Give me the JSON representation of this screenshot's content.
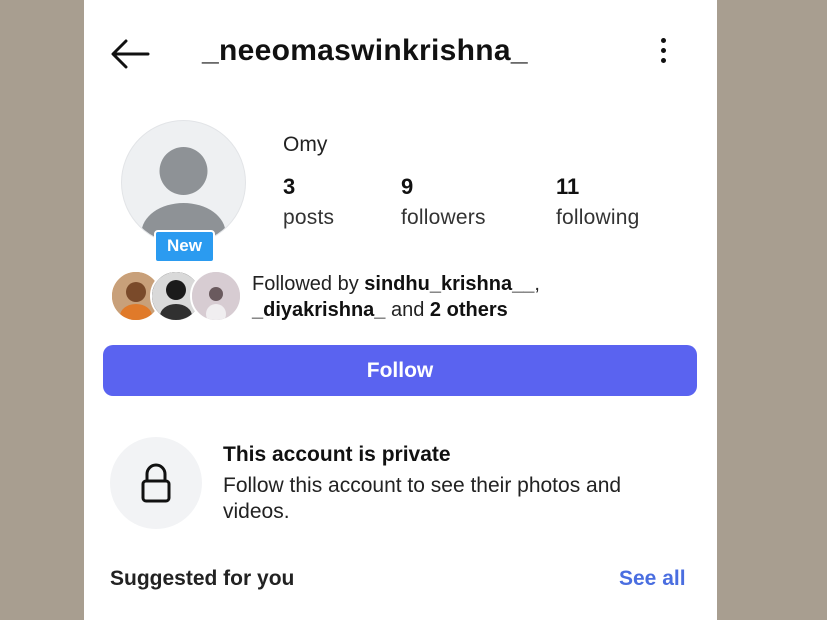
{
  "header": {
    "username": "_neeomaswinkrishna_",
    "back_icon": "arrow-left-icon",
    "menu_icon": "more-vertical-icon"
  },
  "profile": {
    "display_name": "Omy",
    "new_badge": "New",
    "avatar_icon": "default-avatar-icon",
    "stats": {
      "posts": {
        "value": "3",
        "label": "posts"
      },
      "followers": {
        "value": "9",
        "label": "followers"
      },
      "following": {
        "value": "11",
        "label": "following"
      }
    },
    "followed_by": {
      "prefix": "Followed by",
      "user1": "sindhu_krishna__",
      "sep": ",",
      "user2": "_diyakrishna_",
      "and": "and",
      "others": "2 others"
    }
  },
  "actions": {
    "follow_label": "Follow"
  },
  "private": {
    "icon": "lock-icon",
    "title": "This account is private",
    "subtitle": "Follow this account to see their photos and videos."
  },
  "suggested": {
    "title": "Suggested for you",
    "see_all": "See all"
  },
  "colors": {
    "background": "#a89e90",
    "follow_button": "#5a63f0",
    "link": "#4a6ee0",
    "badge": "#2b9bf0"
  }
}
